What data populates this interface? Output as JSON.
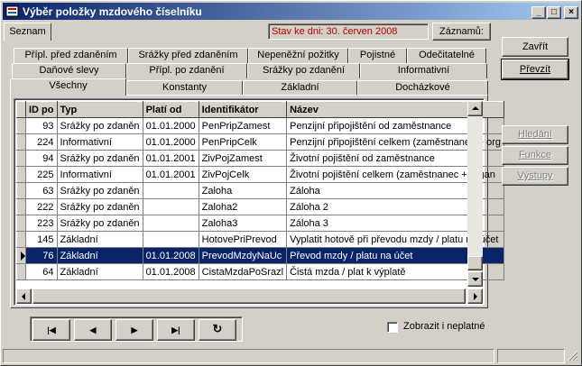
{
  "window": {
    "title": "Výběr položky mzdového číselníku",
    "controls": {
      "minimize": "_",
      "maximize": "□",
      "close": "×"
    }
  },
  "header": {
    "seznam_tab": "Seznam",
    "stav": "Stav ke dni: 30. červen 2008",
    "zaznamu_label": "Záznamů:"
  },
  "tabs": {
    "row1": [
      "Přípl. před zdaněním",
      "Srážky před zdaněním",
      "Nepeněžní požitky",
      "Pojistné",
      "Odečitatelné"
    ],
    "row2": [
      "Daňové slevy",
      "Přípl. po zdanění",
      "Srážky po zdanění",
      "Informativní"
    ],
    "row3": [
      "Všechny",
      "Konstanty",
      "Základní",
      "Docházkové"
    ]
  },
  "grid": {
    "columns": [
      "ID po",
      "Typ",
      "Platí od",
      "Identifikátor",
      "Název"
    ],
    "rows": [
      [
        "93",
        "Srážky po zdaněn",
        "01.01.2000",
        "PenPripZamest",
        "Penzijní připojištění od zaměstnance"
      ],
      [
        "224",
        "Informativní",
        "01.01.2000",
        "PenPripCelk",
        "Penzijní připojištění celkem (zaměstnanec + org"
      ],
      [
        "94",
        "Srážky po zdaněn",
        "01.01.2001",
        "ZivPojZamest",
        "Životní pojištění od zaměstnance"
      ],
      [
        "225",
        "Informativní",
        "01.01.2001",
        "ZivPojCelk",
        "Životní pojištění celkem (zaměstnanec + organ"
      ],
      [
        "63",
        "Srážky po zdaněn",
        "",
        "Zaloha",
        "Záloha"
      ],
      [
        "222",
        "Srážky po zdaněn",
        "",
        "Zaloha2",
        "Záloha 2"
      ],
      [
        "223",
        "Srážky po zdaněn",
        "",
        "Zaloha3",
        "Záloha 3"
      ],
      [
        "145",
        "Základní",
        "",
        "HotovePriPrevod",
        "Vyplatit hotově při převodu mzdy / platu na účet"
      ],
      [
        "76",
        "Základní",
        "01.01.2008",
        "PrevodMzdyNaUc",
        "Převod mzdy / platu na účet"
      ],
      [
        "64",
        "Základní",
        "01.01.2008",
        "CistaMzdaPoSrazl",
        "Čistá mzda / plat k výplatě"
      ]
    ],
    "selected_row": 8
  },
  "right_buttons": {
    "zavrit": "Zavřít",
    "prevzit": "Převzít",
    "hledani": "Hledání",
    "funkce": "Funkce",
    "vystupy": "Výstupy"
  },
  "navigator": {
    "first": "|◀",
    "prev": "◀",
    "next": "▶",
    "last": "▶|",
    "refresh": "↻"
  },
  "checkbox": {
    "label": "Zobrazit i neplatné",
    "checked": false
  }
}
